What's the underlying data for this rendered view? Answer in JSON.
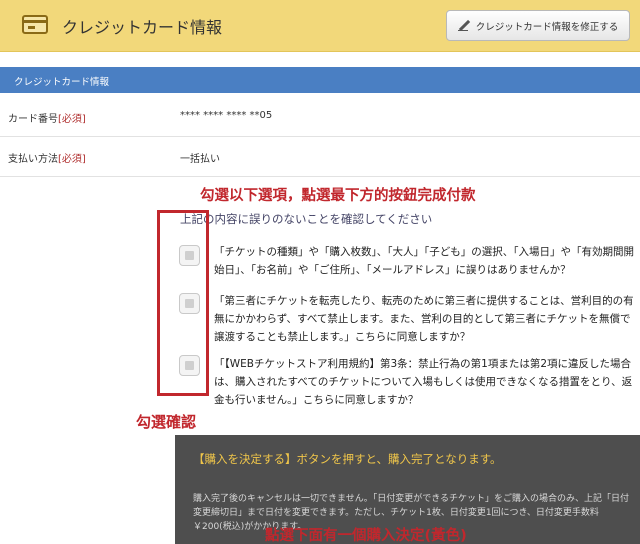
{
  "header": {
    "title": "クレジットカード情報",
    "card_icon": "credit-card-icon",
    "edit_button_label": "クレジットカード情報を修正する",
    "edit_icon": "pencil-icon",
    "bg_color": "#f2d87a"
  },
  "section": {
    "title": "クレジットカード情報",
    "color": "#4a7fc3"
  },
  "fields": [
    {
      "label": "カード番号",
      "required": "[必須]",
      "value": "**** **** **** **05"
    },
    {
      "label": "支払い方法",
      "required": "[必須]",
      "value": "一括払い"
    }
  ],
  "annotations": {
    "top": "勾選以下選項，點選最下方的按鈕完成付款",
    "left": "勾選確認",
    "bottom": "點選下面有一個購入決定(黃色)",
    "color": "#c1272d"
  },
  "confirm": {
    "heading": "上記の内容に誤りのないことを確認してください",
    "items": [
      {
        "text": "「チケットの種類」や「購入枚数」、「大人」「子ども」の選択、「入場日」や「有効期間開始日」、「お名前」や「ご住所」、「メールアドレス」に誤りはありませんか？",
        "checked": false
      },
      {
        "text": "「第三者にチケットを転売したり、転売のために第三者に提供することは、営利目的の有無にかかわらず、すべて禁止します。また、営利の目的として第三者にチケットを無償で譲渡することも禁止します。」こちらに同意しますか？",
        "checked": false
      },
      {
        "text": "「【WEBチケットストア利用規約】第3条：禁止行為の第1項または第2項に違反した場合は、購入されたすべてのチケットについて入場もしくは使用できなくなる措置をとり、返金も行いません。」こちらに同意しますか？",
        "checked": false
      }
    ]
  },
  "notice": {
    "main": "【購入を決定する】ボタンを押すと、購入完了となります。",
    "sub": "購入完了後のキャンセルは一切できません。「日付変更ができるチケット」をご購入の場合のみ、上記「日付変更締切日」まで日付を変更できます。ただし、チケット1枚、日付変更1回につき、日付変更手数料￥200(税込)がかかります。",
    "highlight_color": "#f0c64a"
  }
}
